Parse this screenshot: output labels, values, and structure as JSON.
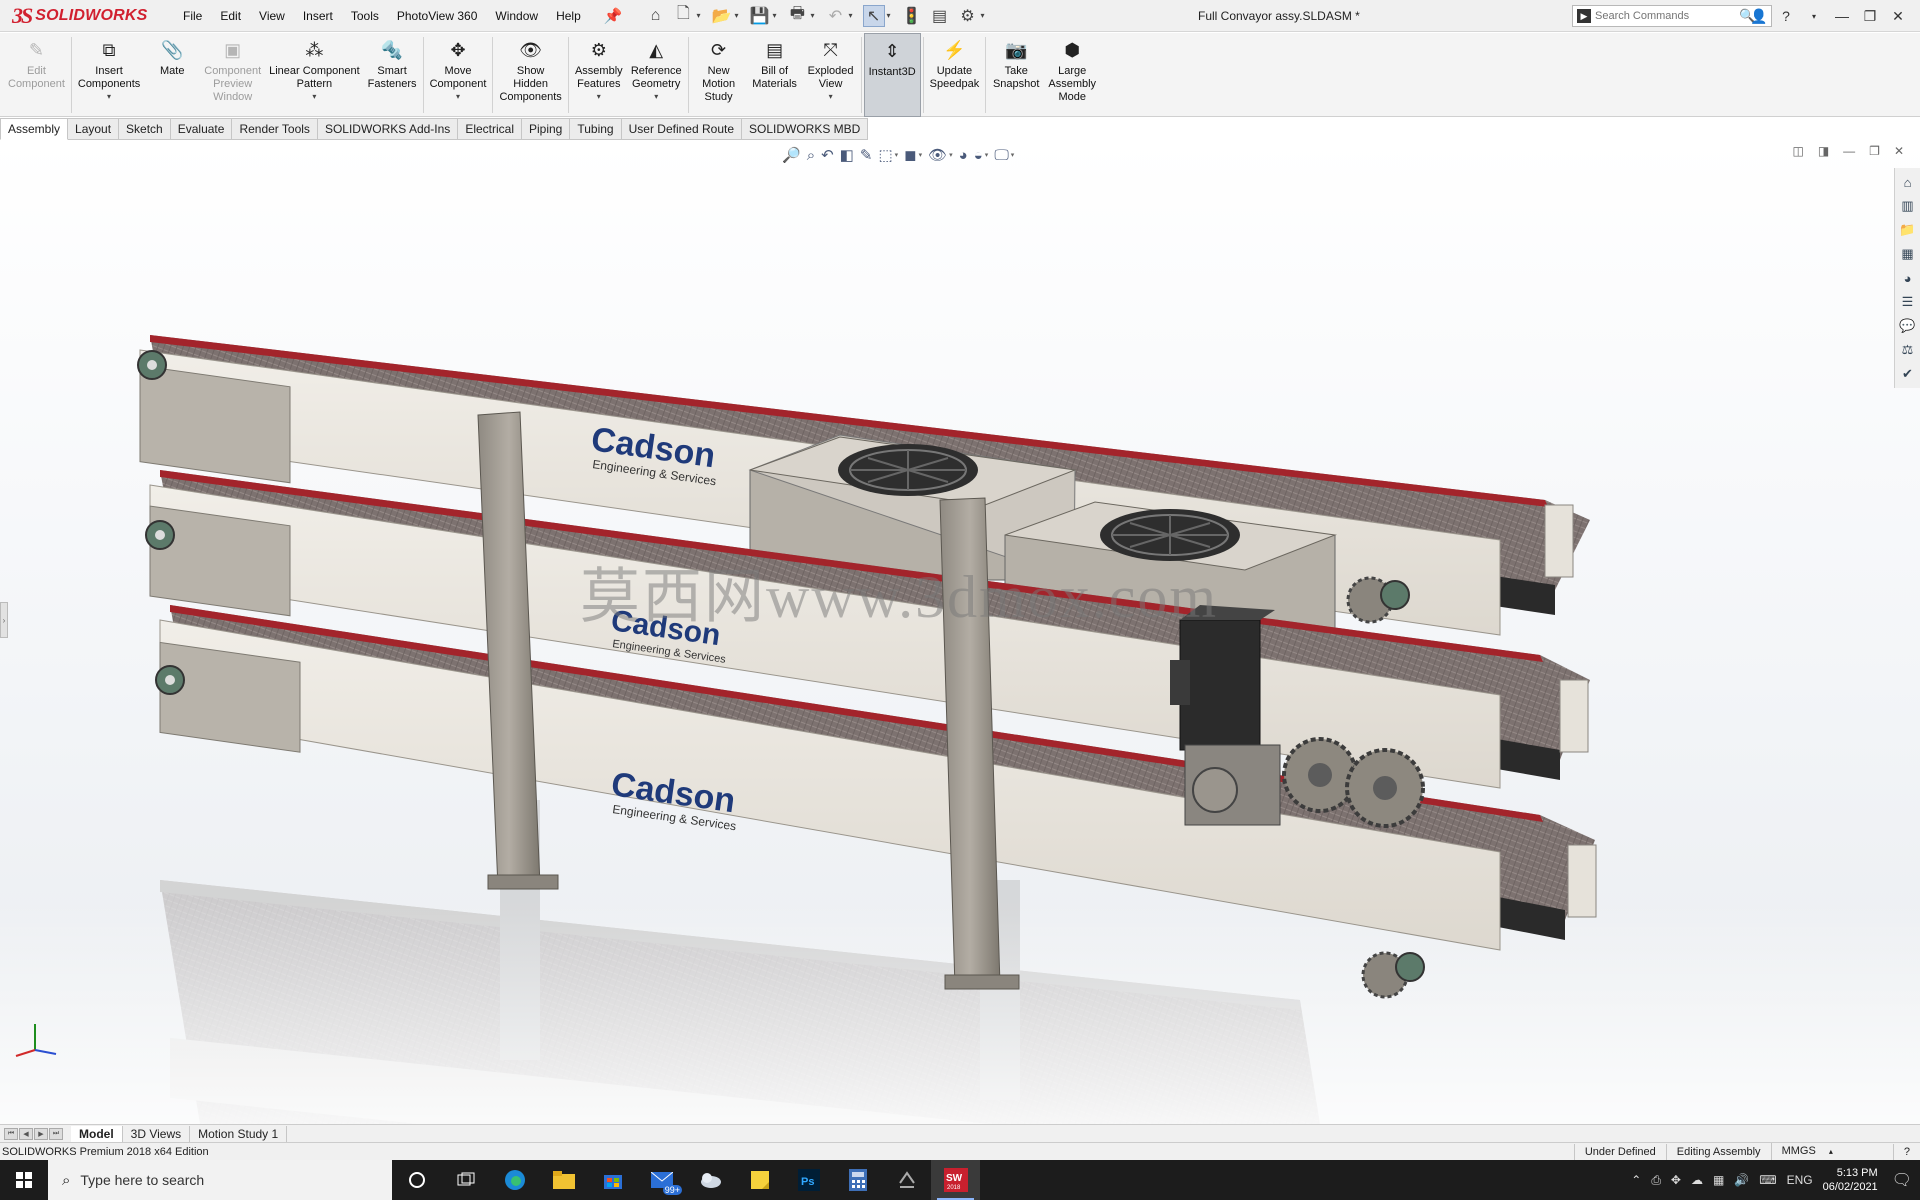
{
  "app": {
    "logo": {
      "ds": "3S",
      "name": "SOLIDWORKS"
    },
    "document_title": "Full Convayor assy.SLDASM *",
    "menus": [
      "File",
      "Edit",
      "View",
      "Insert",
      "Tools",
      "PhotoView 360",
      "Window",
      "Help"
    ],
    "quick_access": [
      {
        "icon": "home-icon"
      },
      {
        "icon": "new-document-icon"
      },
      {
        "icon": "open-folder-icon"
      },
      {
        "icon": "save-icon"
      },
      {
        "icon": "print-icon"
      },
      {
        "icon": "undo-icon"
      },
      {
        "icon": "select-cursor-icon"
      },
      {
        "icon": "rebuild-icon"
      },
      {
        "icon": "file-properties-icon"
      },
      {
        "icon": "options-gear-icon"
      }
    ],
    "search": {
      "placeholder": "Search Commands"
    }
  },
  "ribbon": {
    "buttons": [
      {
        "label": "Edit\nComponent",
        "icon": "edit-component-icon",
        "enabled": false
      },
      {
        "label": "Insert\nComponents",
        "icon": "insert-components-icon",
        "enabled": true,
        "caret": true
      },
      {
        "label": "Mate",
        "icon": "mate-paperclip-icon",
        "enabled": true
      },
      {
        "label": "Component\nPreview\nWindow",
        "icon": "component-preview-icon",
        "enabled": false
      },
      {
        "label": "Linear Component\nPattern",
        "icon": "linear-pattern-icon",
        "enabled": true,
        "caret": true
      },
      {
        "label": "Smart\nFasteners",
        "icon": "smart-fasteners-icon",
        "enabled": true
      },
      {
        "label": "Move\nComponent",
        "icon": "move-component-icon",
        "enabled": true,
        "caret": true
      },
      {
        "label": "Show\nHidden\nComponents",
        "icon": "show-hidden-icon",
        "enabled": true
      },
      {
        "label": "Assembly\nFeatures",
        "icon": "assembly-features-icon",
        "enabled": true,
        "caret": true
      },
      {
        "label": "Reference\nGeometry",
        "icon": "reference-geometry-icon",
        "enabled": true,
        "caret": true
      },
      {
        "label": "New\nMotion\nStudy",
        "icon": "motion-study-icon",
        "enabled": true
      },
      {
        "label": "Bill of\nMaterials",
        "icon": "bill-of-materials-icon",
        "enabled": true
      },
      {
        "label": "Exploded\nView",
        "icon": "exploded-view-icon",
        "enabled": true,
        "caret": true
      },
      {
        "label": "Instant3D",
        "icon": "instant3d-icon",
        "enabled": true,
        "active": true
      },
      {
        "label": "Update\nSpeedpak",
        "icon": "speedpak-icon",
        "enabled": true
      },
      {
        "label": "Take\nSnapshot",
        "icon": "camera-snapshot-icon",
        "enabled": true
      },
      {
        "label": "Large\nAssembly\nMode",
        "icon": "large-assembly-icon",
        "enabled": true
      }
    ]
  },
  "tabs": [
    "Assembly",
    "Layout",
    "Sketch",
    "Evaluate",
    "Render Tools",
    "SOLIDWORKS Add-Ins",
    "Electrical",
    "Piping",
    "Tubing",
    "User Defined Route",
    "SOLIDWORKS MBD"
  ],
  "active_tab": "Assembly",
  "viewport": {
    "watermark": "莫西网www.3dmox.com",
    "brand_text": "Cadson",
    "brand_sub": "Engineering & Services"
  },
  "model_tabs": [
    "Model",
    "3D Views",
    "Motion Study 1"
  ],
  "status": {
    "product": "SOLIDWORKS Premium 2018 x64 Edition",
    "definition": "Under Defined",
    "mode": "Editing Assembly",
    "units": "MMGS"
  },
  "taskbar": {
    "search_placeholder": "Type here to search",
    "mail_badge": "99+",
    "sw_label": "SW\n2018",
    "language": "ENG",
    "time": "5:13 PM",
    "date": "06/02/2021"
  },
  "colors": {
    "brand_red": "#d1202f",
    "frame": "#e8e4dc",
    "belt": "#7a6f6c",
    "belt_edge": "#a3242b",
    "housing": "#c9c5bd",
    "motor": "#2b2b2b"
  }
}
